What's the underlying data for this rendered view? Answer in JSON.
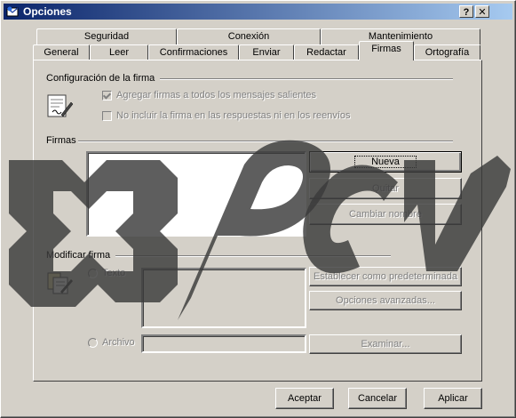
{
  "window": {
    "title": "Opciones",
    "help_label": "?",
    "close_label": "✕"
  },
  "tabs_row1": [
    "Seguridad",
    "Conexión",
    "Mantenimiento"
  ],
  "tabs_row2": [
    "General",
    "Leer",
    "Confirmaciones",
    "Enviar",
    "Redactar",
    "Firmas",
    "Ortografía"
  ],
  "active_tab": "Firmas",
  "config": {
    "title": "Configuración de la firma",
    "add_signature": {
      "label": "Agregar firmas a todos los mensajes salientes",
      "checked": true
    },
    "no_include": {
      "label": "No incluir la firma en las respuestas ni en los reenvíos",
      "checked": false
    }
  },
  "firmas": {
    "title": "Firmas",
    "list_items": [],
    "new_button": "Nueva",
    "remove_button": "Quitar",
    "rename_button": "Cambiar nombre"
  },
  "modificar": {
    "title": "Modificar firma",
    "text_option": "Texto",
    "file_option": "Archivo",
    "text_value": "",
    "file_value": "",
    "set_default_button": "Establecer como predeterminada",
    "advanced_button": "Opciones avanzadas...",
    "browse_button": "Examinar..."
  },
  "footer": {
    "accept": "Aceptar",
    "cancel": "Cancelar",
    "apply": "Aplicar"
  },
  "icons": [
    "app-icon",
    "signature-pen-icon",
    "edit-signature-icon"
  ]
}
